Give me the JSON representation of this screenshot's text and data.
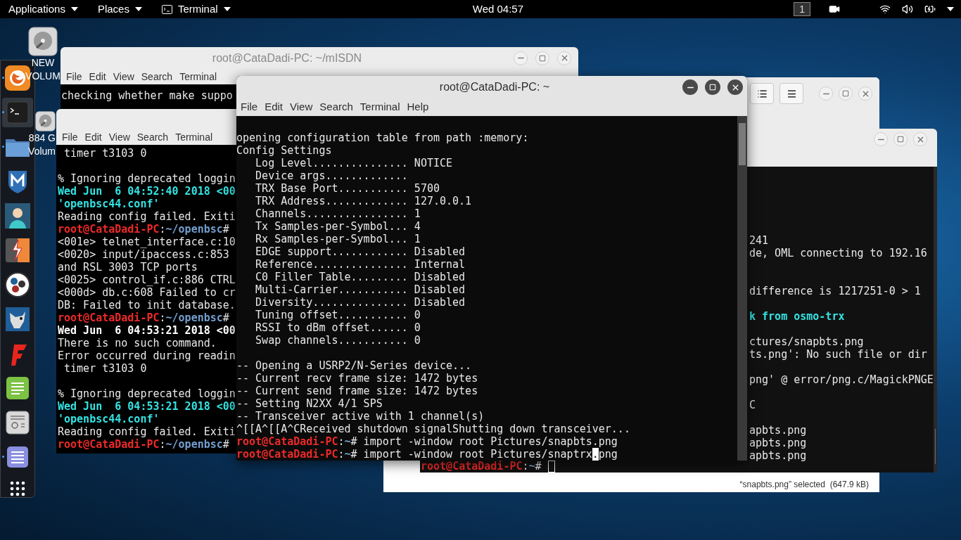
{
  "top_bar": {
    "menus": [
      {
        "label": "Applications"
      },
      {
        "label": "Places"
      },
      {
        "label": "Terminal"
      }
    ],
    "clock": "Wed 04:57",
    "workspace": "1"
  },
  "dock": {
    "items": [
      {
        "running": true,
        "selected": false
      },
      {
        "running": true,
        "selected": true
      },
      {
        "running": true,
        "selected": false
      },
      {
        "running": false,
        "selected": false
      },
      {
        "running": false,
        "selected": false
      },
      {
        "running": false,
        "selected": false
      },
      {
        "running": false,
        "selected": false
      },
      {
        "running": false,
        "selected": false
      },
      {
        "running": false,
        "selected": false
      },
      {
        "running": false,
        "selected": false
      },
      {
        "running": false,
        "selected": false
      },
      {
        "running": true,
        "selected": false
      }
    ]
  },
  "desktop_icons": [
    {
      "lines": [
        "NEW",
        "VOLUM"
      ]
    },
    {
      "lines": [
        "884 G",
        "Volum"
      ]
    }
  ],
  "window_misdn": {
    "title": "root@CataDadi-PC: ~/mISDN",
    "menu": [
      "File",
      "Edit",
      "View",
      "Search",
      "Terminal"
    ],
    "lines": [
      "checking whether make suppo"
    ]
  },
  "window_openbsc": {
    "menu": [
      "File",
      "Edit",
      "View",
      "Search",
      "Terminal"
    ],
    "lines": [
      {
        "kind": "line",
        "segments": [
          {
            "text": " timer t3103 0",
            "kind": "plain"
          }
        ]
      },
      {
        "kind": "blank"
      },
      {
        "kind": "line",
        "segments": [
          {
            "text": "% Ignoring deprecated loggin",
            "kind": "plain"
          }
        ]
      },
      {
        "kind": "line",
        "segments": [
          {
            "text": "Wed Jun  6 04:52:40 2018 <00",
            "kind": "date"
          }
        ]
      },
      {
        "kind": "line",
        "segments": [
          {
            "text": "'openbsc44.conf'",
            "kind": "date"
          }
        ]
      },
      {
        "kind": "line",
        "segments": [
          {
            "text": "Reading config failed. Exiti",
            "kind": "plain"
          }
        ]
      },
      {
        "kind": "line",
        "segments": [
          {
            "text": "root@CataDadi-PC",
            "kind": "user"
          },
          {
            "text": ":",
            "kind": "plain"
          },
          {
            "text": "~/openbsc",
            "kind": "path"
          },
          {
            "text": "#",
            "kind": "plain"
          }
        ]
      },
      {
        "kind": "line",
        "segments": [
          {
            "text": "<001e> telnet_interface.c:10",
            "kind": "plain"
          }
        ]
      },
      {
        "kind": "line",
        "segments": [
          {
            "text": "<0020> input/ipaccess.c:853",
            "kind": "plain"
          }
        ]
      },
      {
        "kind": "line",
        "segments": [
          {
            "text": "and RSL 3003 TCP ports",
            "kind": "plain"
          }
        ]
      },
      {
        "kind": "line",
        "segments": [
          {
            "text": "<0025> control_if.c:886 CTRL",
            "kind": "plain"
          }
        ]
      },
      {
        "kind": "line",
        "segments": [
          {
            "text": "<000d> db.c:608 Failed to cr",
            "kind": "plain"
          }
        ]
      },
      {
        "kind": "line",
        "segments": [
          {
            "text": "DB: Failed to init database.",
            "kind": "plain"
          }
        ]
      },
      {
        "kind": "line",
        "segments": [
          {
            "text": "root@CataDadi-PC",
            "kind": "user"
          },
          {
            "text": ":",
            "kind": "plain"
          },
          {
            "text": "~/openbsc",
            "kind": "path"
          },
          {
            "text": "#",
            "kind": "plain"
          }
        ]
      },
      {
        "kind": "line",
        "segments": [
          {
            "text": "Wed Jun  6 04:53:21 2018 <00",
            "kind": "bold"
          }
        ]
      },
      {
        "kind": "line",
        "segments": [
          {
            "text": "There is no such command.",
            "kind": "plain"
          }
        ]
      },
      {
        "kind": "line",
        "segments": [
          {
            "text": "Error occurred during readin",
            "kind": "plain"
          }
        ]
      },
      {
        "kind": "line",
        "segments": [
          {
            "text": " timer t3103 0",
            "kind": "plain"
          }
        ]
      },
      {
        "kind": "blank"
      },
      {
        "kind": "line",
        "segments": [
          {
            "text": "% Ignoring deprecated loggin",
            "kind": "plain"
          }
        ]
      },
      {
        "kind": "line",
        "segments": [
          {
            "text": "Wed Jun  6 04:53:21 2018 <00",
            "kind": "date"
          }
        ]
      },
      {
        "kind": "line",
        "segments": [
          {
            "text": "'openbsc44.conf'",
            "kind": "date"
          }
        ]
      },
      {
        "kind": "line",
        "segments": [
          {
            "text": "Reading config failed. Exiti",
            "kind": "plain"
          }
        ]
      },
      {
        "kind": "line",
        "segments": [
          {
            "text": "root@CataDadi-PC",
            "kind": "user"
          },
          {
            "text": ":",
            "kind": "plain"
          },
          {
            "text": "~/openbsc",
            "kind": "path"
          },
          {
            "text": "#",
            "kind": "plain"
          }
        ]
      }
    ]
  },
  "window_files": {
    "status": "“snapbts.png” selected  (647.9 kB)"
  },
  "window_osmo_bts": {
    "lines": [
      {
        "kind": "covered",
        "segments": [
          {
            "text": "241",
            "kind": "plain"
          }
        ]
      },
      {
        "kind": "covered",
        "segments": [
          {
            "text": "de, OML connecting to 192.16",
            "kind": "plain"
          }
        ]
      },
      {
        "kind": "blank"
      },
      {
        "kind": "blank"
      },
      {
        "kind": "covered",
        "segments": [
          {
            "text": "difference is 1217251-0 > 1",
            "kind": "plain"
          }
        ]
      },
      {
        "kind": "blank"
      },
      {
        "kind": "covered",
        "segments": [
          {
            "text": "k from osmo-trx",
            "kind": "date"
          }
        ]
      },
      {
        "kind": "blank"
      },
      {
        "kind": "covered",
        "segments": [
          {
            "text": "ctures/snapbts.png",
            "kind": "plain"
          }
        ]
      },
      {
        "kind": "covered",
        "segments": [
          {
            "text": "ts.png': No such file or dir",
            "kind": "plain"
          }
        ]
      },
      {
        "kind": "blank"
      },
      {
        "kind": "covered",
        "segments": [
          {
            "text": "png' @ error/png.c/MagickPNGE",
            "kind": "plain"
          }
        ]
      },
      {
        "kind": "blank"
      },
      {
        "kind": "covered",
        "segments": [
          {
            "text": "C",
            "kind": "plain"
          }
        ]
      },
      {
        "kind": "blank"
      },
      {
        "kind": "covered",
        "segments": [
          {
            "text": "apbts.png",
            "kind": "plain"
          }
        ]
      },
      {
        "kind": "covered",
        "segments": [
          {
            "text": "apbts.png",
            "kind": "plain"
          }
        ]
      },
      {
        "kind": "covered",
        "segments": [
          {
            "text": "apbts.png",
            "kind": "plain"
          }
        ]
      },
      {
        "kind": "prompt",
        "segments": [
          {
            "text": "root@CataDadi-PC",
            "kind": "user"
          },
          {
            "text": ":",
            "kind": "plain"
          },
          {
            "text": "~",
            "kind": "path"
          },
          {
            "text": "# ",
            "kind": "plain"
          }
        ]
      }
    ]
  },
  "window_main": {
    "title": "root@CataDadi-PC: ~",
    "menu": [
      "File",
      "Edit",
      "View",
      "Search",
      "Terminal",
      "Help"
    ],
    "lines": [
      {
        "kind": "line",
        "segments": [
          {
            "text": "opening configuration table from path :memory:",
            "kind": "plain"
          }
        ]
      },
      {
        "kind": "line",
        "segments": [
          {
            "text": "Config Settings",
            "kind": "plain"
          }
        ]
      },
      {
        "kind": "line",
        "segments": [
          {
            "text": "   Log Level............... NOTICE",
            "kind": "plain"
          }
        ]
      },
      {
        "kind": "line",
        "segments": [
          {
            "text": "   Device args.............",
            "kind": "plain"
          }
        ]
      },
      {
        "kind": "line",
        "segments": [
          {
            "text": "   TRX Base Port........... 5700",
            "kind": "plain"
          }
        ]
      },
      {
        "kind": "line",
        "segments": [
          {
            "text": "   TRX Address............. 127.0.0.1",
            "kind": "plain"
          }
        ]
      },
      {
        "kind": "line",
        "segments": [
          {
            "text": "   Channels................ 1",
            "kind": "plain"
          }
        ]
      },
      {
        "kind": "line",
        "segments": [
          {
            "text": "   Tx Samples-per-Symbol... 4",
            "kind": "plain"
          }
        ]
      },
      {
        "kind": "line",
        "segments": [
          {
            "text": "   Rx Samples-per-Symbol... 1",
            "kind": "plain"
          }
        ]
      },
      {
        "kind": "line",
        "segments": [
          {
            "text": "   EDGE support............ Disabled",
            "kind": "plain"
          }
        ]
      },
      {
        "kind": "line",
        "segments": [
          {
            "text": "   Reference............... Internal",
            "kind": "plain"
          }
        ]
      },
      {
        "kind": "line",
        "segments": [
          {
            "text": "   C0 Filler Table......... Disabled",
            "kind": "plain"
          }
        ]
      },
      {
        "kind": "line",
        "segments": [
          {
            "text": "   Multi-Carrier........... Disabled",
            "kind": "plain"
          }
        ]
      },
      {
        "kind": "line",
        "segments": [
          {
            "text": "   Diversity............... Disabled",
            "kind": "plain"
          }
        ]
      },
      {
        "kind": "line",
        "segments": [
          {
            "text": "   Tuning offset........... 0",
            "kind": "plain"
          }
        ]
      },
      {
        "kind": "line",
        "segments": [
          {
            "text": "   RSSI to dBm offset...... 0",
            "kind": "plain"
          }
        ]
      },
      {
        "kind": "line",
        "segments": [
          {
            "text": "   Swap channels........... 0",
            "kind": "plain"
          }
        ]
      },
      {
        "kind": "blank"
      },
      {
        "kind": "line",
        "segments": [
          {
            "text": "-- Opening a USRP2/N-Series device...",
            "kind": "plain"
          }
        ]
      },
      {
        "kind": "line",
        "segments": [
          {
            "text": "-- Current recv frame size: 1472 bytes",
            "kind": "plain"
          }
        ]
      },
      {
        "kind": "line",
        "segments": [
          {
            "text": "-- Current send frame size: 1472 bytes",
            "kind": "plain"
          }
        ]
      },
      {
        "kind": "line",
        "segments": [
          {
            "text": "-- Setting N2XX 4/1 SPS",
            "kind": "plain"
          }
        ]
      },
      {
        "kind": "line",
        "segments": [
          {
            "text": "-- Transceiver active with 1 channel(s)",
            "kind": "plain"
          }
        ]
      },
      {
        "kind": "line",
        "segments": [
          {
            "text": "^[[A^[[A^CReceived shutdown signalShutting down transceiver...",
            "kind": "plain"
          }
        ]
      },
      {
        "kind": "line",
        "segments": [
          {
            "text": "root@CataDadi-PC",
            "kind": "user"
          },
          {
            "text": ":",
            "kind": "plain"
          },
          {
            "text": "~",
            "kind": "path"
          },
          {
            "text": "# import -window root Pictures/snapbts.png",
            "kind": "plain"
          }
        ]
      },
      {
        "kind": "line",
        "segments": [
          {
            "text": "root@CataDadi-PC",
            "kind": "user"
          },
          {
            "text": ":",
            "kind": "plain"
          },
          {
            "text": "~",
            "kind": "path"
          },
          {
            "text": "# import -window root Pictures/snaptrx",
            "kind": "plain"
          },
          {
            "text": ".",
            "kind": "cursor"
          },
          {
            "text": "png",
            "kind": "plain"
          }
        ]
      }
    ]
  }
}
